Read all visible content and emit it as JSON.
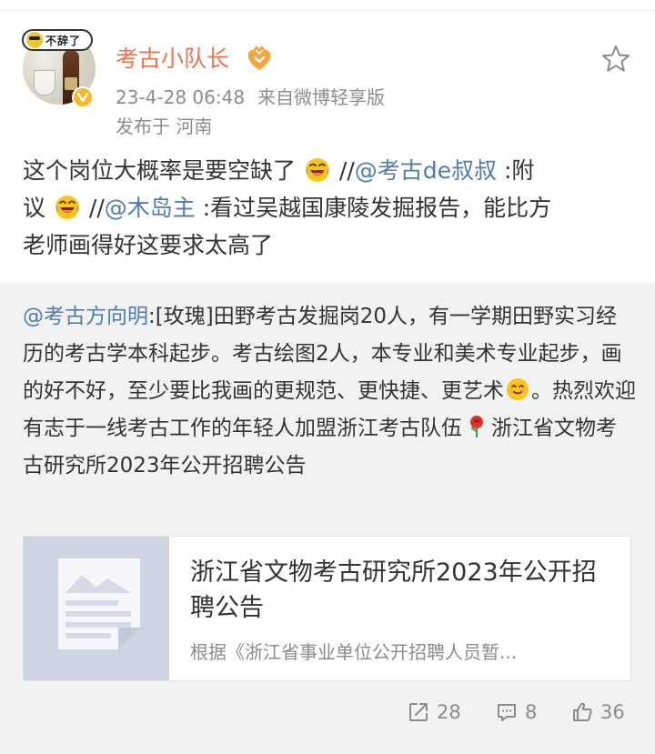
{
  "post": {
    "username": "考古小队长",
    "timestamp": "23-4-28 06:48",
    "source": "来自微博轻享版",
    "location": "发布于 河南",
    "sticker_text": "不辞了",
    "text": {
      "line1_prefix": "这个岗位大概率是要空缺了",
      "sep1": "//",
      "mention1": "@考古de叔叔",
      "line1_suffix": " :附",
      "line2_prefix": "议",
      "sep2": "//",
      "mention2": "@木岛主",
      "line2_suffix": " :看过吴越国康陵发掘报告，能比方",
      "line3": "老师画得好这要求太高了"
    }
  },
  "repost": {
    "mention": "@考古方向明",
    "text_part1": ":[玫瑰]田野考古发掘岗20人，有一学期田野实习经历的考古学本科起步。考古绘图2人，本专业和美术专业起步，画的好不好，至少要比我画的更规范、更快捷、更艺术",
    "text_part2": "。热烈欢迎有志于一线考古工作的年轻人加盟浙江考古队伍",
    "text_part3": "浙江省文物考古研究所2023年公开招聘公告",
    "card": {
      "title": "浙江省文物考古研究所2023年公开招聘公告",
      "description": "根据《浙江省事业单位公开招聘人员暂..."
    }
  },
  "actions": {
    "share_count": "28",
    "comment_count": "8",
    "like_count": "36"
  },
  "colors": {
    "username": "#eb7350",
    "mention": "#507daf",
    "meta": "#8c8c8c",
    "repost_bg": "#f2f2f2"
  },
  "icons": [
    "star-icon",
    "vip-badge-icon",
    "verified-icon",
    "laugh-emoji-icon",
    "smile-emoji-icon",
    "rose-emoji-icon",
    "share-icon",
    "comment-icon",
    "like-icon",
    "article-thumbnail-icon"
  ]
}
